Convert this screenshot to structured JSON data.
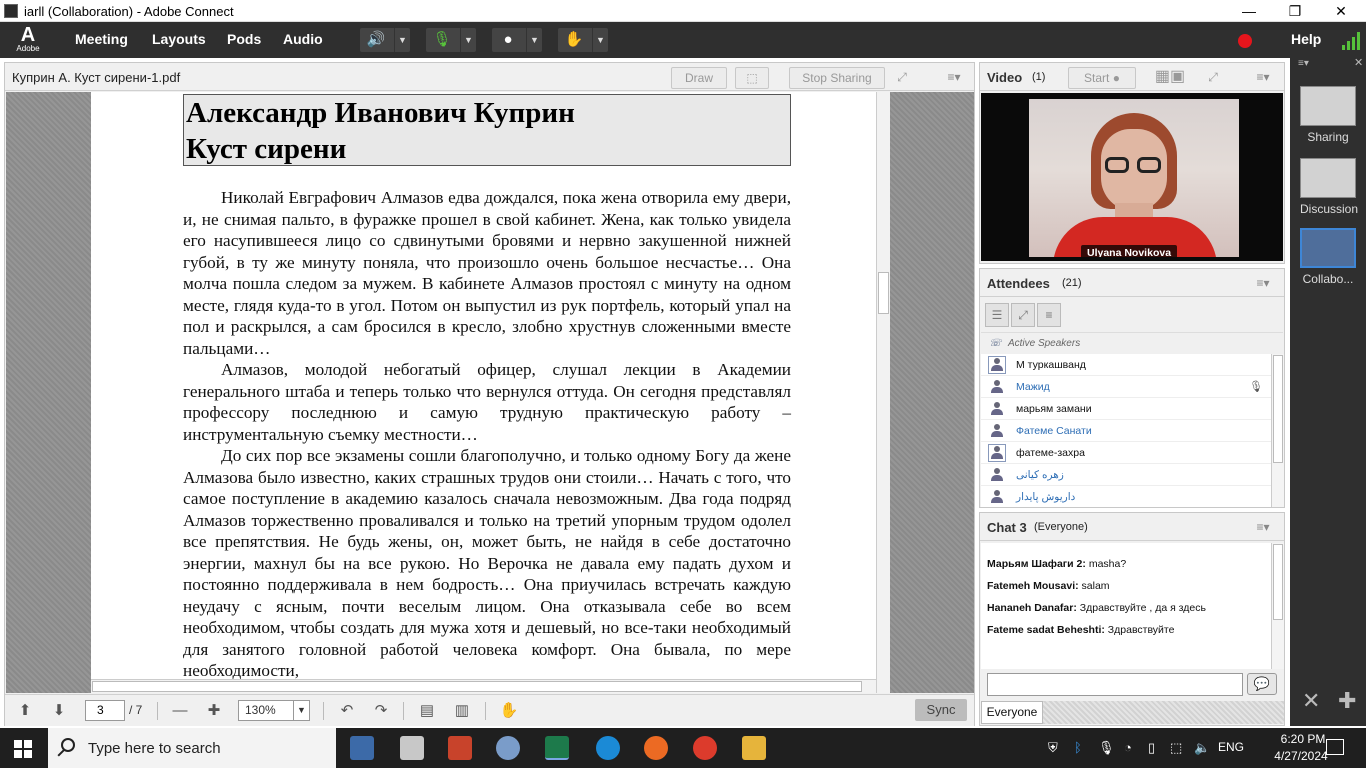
{
  "window": {
    "title": "iarll (Collaboration) - Adobe Connect",
    "minimize": "—",
    "restore": "❐",
    "close": "✕"
  },
  "menubar": {
    "logo_letter": "A",
    "logo_text": "Adobe",
    "items": [
      "Meeting",
      "Layouts",
      "Pods",
      "Audio"
    ],
    "help": "Help",
    "record_color": "#e5151c",
    "signal_color": "#56c13b"
  },
  "share_pod": {
    "title": "Куприн А. Куст сирени-1.pdf",
    "draw": "Draw",
    "stop_sharing": "Stop Sharing",
    "document": {
      "heading_line1": "Александр Иванович Куприн",
      "heading_line2": "Куст сирени",
      "paragraphs": [
        "Николай Евграфович Алмазов едва дождался, пока жена отворила ему двери, и, не снимая пальто, в фуражке прошел в свой кабинет. Жена, как только увидела его насупившееся лицо со сдвинутыми бровями и нервно закушенной нижней губой, в ту же минуту поняла, что произошло очень большое несчастье… Она молча пошла следом за мужем. В кабинете Алмазов простоял с минуту на одном месте, глядя куда-то в угол. Потом он выпустил из рук портфель, который упал на пол и раскрылся, а сам бросился в кресло, злобно хрустнув сложенными вместе пальцами…",
        "Алмазов, молодой небогатый офицер, слушал лекции в Академии генерального штаба и теперь только что вернулся оттуда. Он сегодня представлял профессору последнюю и самую трудную практическую работу – инструментальную съемку местности…",
        "До сих пор все экзамены сошли благополучно, и только одному Богу да жене Алмазова было известно, каких страшных трудов они стоили… Начать с того, что самое поступление в академию казалось сначала невозможным. Два года подряд Алмазов торжественно проваливался и только на третий упорным трудом одолел все препятствия. Не будь жены, он, может быть, не найдя в себе достаточно энергии, махнул бы на все рукою. Но Верочка не давала ему падать духом и постоянно поддерживала в нем бодрость… Она приучилась встречать каждую неудачу с ясным, почти веселым лицом. Она отказывала себе во всем необходимом, чтобы создать для мужа хотя и дешевый, но все-таки необходимый для занятого головной работой человека комфорт. Она бывала, по мере необходимости,"
      ]
    },
    "footer": {
      "current_page": "3",
      "total_pages": "/ 7",
      "zoom": "130%",
      "sync": "Sync"
    }
  },
  "video_pod": {
    "title": "Video",
    "count": "(1)",
    "start": "Start",
    "speaker_name": "Ulyana Novikova"
  },
  "attendees_pod": {
    "title": "Attendees",
    "count": "(21)",
    "active_speakers": "Active Speakers",
    "attendees": [
      {
        "name": "M туркашванд",
        "host": true,
        "blue": false,
        "mic": false
      },
      {
        "name": "Мажид",
        "host": false,
        "blue": true,
        "mic": true
      },
      {
        "name": "марьям замани",
        "host": false,
        "blue": false,
        "mic": false
      },
      {
        "name": "Фатеме Санати",
        "host": false,
        "blue": true,
        "mic": false
      },
      {
        "name": "фатеме-захра",
        "host": true,
        "blue": false,
        "mic": false
      },
      {
        "name": "زهره کیانی",
        "host": false,
        "blue": true,
        "mic": false
      },
      {
        "name": "داریوش پایدار",
        "host": false,
        "blue": true,
        "mic": false
      }
    ]
  },
  "chat_pod": {
    "title": "Chat 3",
    "scope": "(Everyone)",
    "messages": [
      {
        "sender": "Марьям Шафаги 2:",
        "text": "masha?"
      },
      {
        "sender": "Fatemeh Mousavi:",
        "text": "salam"
      },
      {
        "sender": "Hananeh Danafar:",
        "text": "Здравствуйте , да я здесь"
      },
      {
        "sender": "Fateme sadat Beheshti:",
        "text": "Здравствуйте"
      }
    ],
    "tab": "Everyone"
  },
  "layouts_rail": {
    "items": [
      "Sharing",
      "Discussion",
      "Collabo..."
    ]
  },
  "taskbar": {
    "search_placeholder": "Type here to search",
    "language": "ENG",
    "time": "6:20 PM",
    "date": "4/27/2024"
  }
}
